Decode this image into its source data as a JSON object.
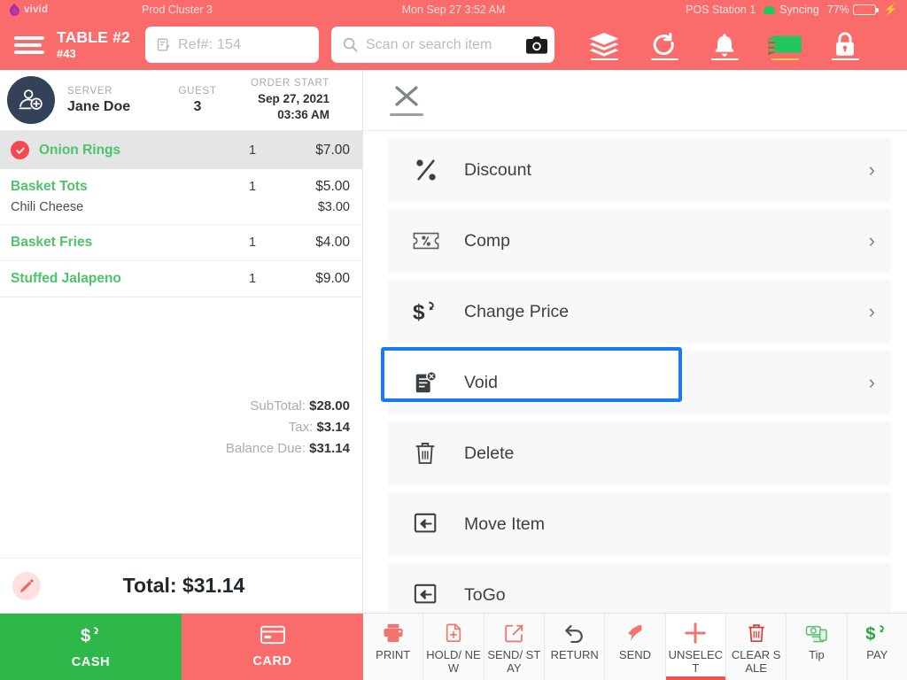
{
  "statusbar": {
    "brand": "vivid",
    "cluster": "Prod Cluster 3",
    "datetime": "Mon Sep 27 3:52 AM",
    "station": "POS Station 1",
    "sync_status": "Syncing",
    "battery_percent": "77%",
    "battery_level": 77,
    "charging_icon": "bolt-icon"
  },
  "toolbar": {
    "menu_icon": "hamburger-icon",
    "table_name": "TABLE #2",
    "table_number": "#43",
    "ref_value": "Ref#: 154",
    "ref_icon": "note-edit-icon",
    "search_placeholder": "Scan or search item",
    "search_icon": "search-icon",
    "camera_icon": "camera-icon",
    "icons": [
      {
        "name": "layers-icon",
        "label": "Layers"
      },
      {
        "name": "refresh-undo-icon",
        "label": "Refresh"
      },
      {
        "name": "bell-icon",
        "label": "Notifications"
      },
      {
        "name": "cash-stack-icon",
        "label": "Cash Drawer"
      },
      {
        "name": "lock-icon",
        "label": "Lock"
      }
    ]
  },
  "order": {
    "avatar_icon": "add-user-icon",
    "server_label": "SERVER",
    "server_name": "Jane Doe",
    "guest_label": "GUEST",
    "guest_count": "3",
    "order_start_label": "ORDER START",
    "order_start_date": "Sep 27, 2021",
    "order_start_time": "03:36 AM",
    "items": [
      {
        "name": "Onion Rings",
        "qty": "1",
        "price": "$7.00",
        "selected": true,
        "modifier": null,
        "modifier_price": null
      },
      {
        "name": "Basket Tots",
        "qty": "1",
        "price": "$5.00",
        "selected": false,
        "modifier": "Chili Cheese",
        "modifier_price": "$3.00"
      },
      {
        "name": "Basket Fries",
        "qty": "1",
        "price": "$4.00",
        "selected": false,
        "modifier": null,
        "modifier_price": null
      },
      {
        "name": "Stuffed Jalapeno",
        "qty": "1",
        "price": "$9.00",
        "selected": false,
        "modifier": null,
        "modifier_price": null
      }
    ],
    "subtotal_label": "SubTotal:",
    "subtotal_value": "$28.00",
    "tax_label": "Tax:",
    "tax_value": "$3.14",
    "balance_label": "Balance Due:",
    "balance_value": "$31.14",
    "edit_icon": "pencil-icon",
    "grand_total": "Total: $31.14"
  },
  "menu": {
    "close_icon": "close-icon",
    "items": [
      {
        "label": "Discount",
        "icon": "percent-icon",
        "chevron": "›",
        "focused": false
      },
      {
        "label": "Comp",
        "icon": "ticket-percent-icon",
        "chevron": "›",
        "focused": false
      },
      {
        "label": "Change Price",
        "icon": "dollar-arrow-icon",
        "chevron": "›",
        "focused": false
      },
      {
        "label": "Void",
        "icon": "void-document-icon",
        "chevron": "›",
        "focused": true
      },
      {
        "label": "Delete",
        "icon": "trash-icon",
        "chevron": "",
        "focused": false
      },
      {
        "label": "Move Item",
        "icon": "move-item-icon",
        "chevron": "",
        "focused": false
      },
      {
        "label": "ToGo",
        "icon": "togo-icon",
        "chevron": "",
        "focused": false
      }
    ]
  },
  "bottombar": {
    "cash_label": "CASH",
    "cash_icon": "dollar-arrow-icon",
    "card_label": "CARD",
    "card_icon": "credit-card-icon",
    "actions": [
      {
        "label": "PRINT",
        "icon": "printer-icon",
        "active": false
      },
      {
        "label": "HOLD/ NEW",
        "icon": "hold-new-icon",
        "active": false
      },
      {
        "label": "SEND/ STAY",
        "icon": "send-stay-icon",
        "active": false
      },
      {
        "label": "RETURN",
        "icon": "return-arrow-icon",
        "active": false
      },
      {
        "label": "SEND",
        "icon": "send-arrow-icon",
        "active": false
      },
      {
        "label": "UNSELECT",
        "icon": "plus-icon",
        "active": true
      },
      {
        "label": "CLEAR SALE",
        "icon": "trash-icon",
        "active": false
      },
      {
        "label": "Tip",
        "icon": "money-tip-icon",
        "active": false
      },
      {
        "label": "PAY",
        "icon": "dollar-arrow-icon",
        "active": false
      }
    ]
  },
  "colors": {
    "header_red": "#fa6c6c",
    "accent_green": "#4cc36a",
    "cash_green": "#2eb84a",
    "focus_blue": "#1a7af0",
    "avatar_navy": "#334159",
    "check_red": "#f8484f"
  }
}
